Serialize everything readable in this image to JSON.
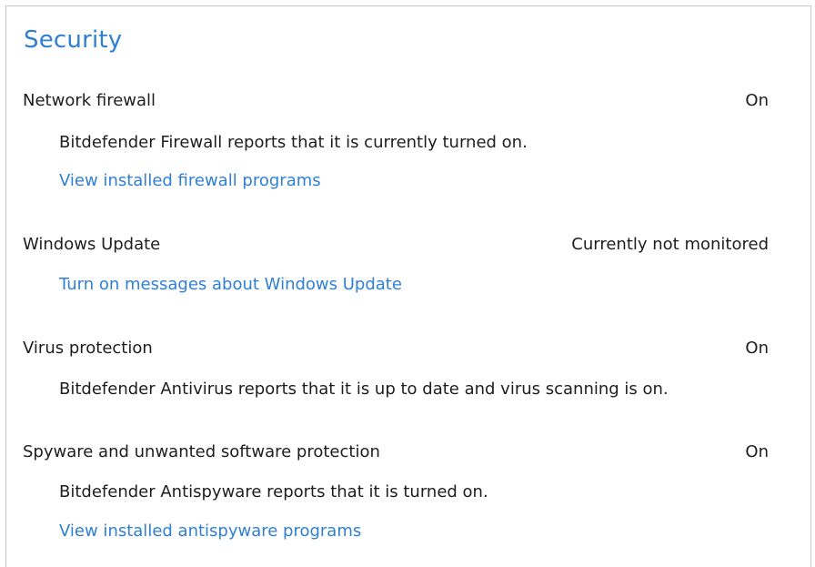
{
  "section": {
    "title": "Security"
  },
  "items": [
    {
      "label": "Network firewall",
      "status": "On",
      "description": "Bitdefender Firewall reports that it is currently turned on.",
      "link": "View installed firewall programs"
    },
    {
      "label": "Windows Update",
      "status": "Currently not monitored",
      "link": "Turn on messages about Windows Update"
    },
    {
      "label": "Virus protection",
      "status": "On",
      "description": "Bitdefender Antivirus reports that it is up to date and virus scanning is on."
    },
    {
      "label": "Spyware and unwanted software protection",
      "status": "On",
      "description": "Bitdefender Antispyware reports that it is turned on.",
      "link": "View installed antispyware programs"
    }
  ],
  "colors": {
    "accent": "#2f7fd3",
    "text": "#1e1e1e",
    "border": "#c9c9c9"
  }
}
